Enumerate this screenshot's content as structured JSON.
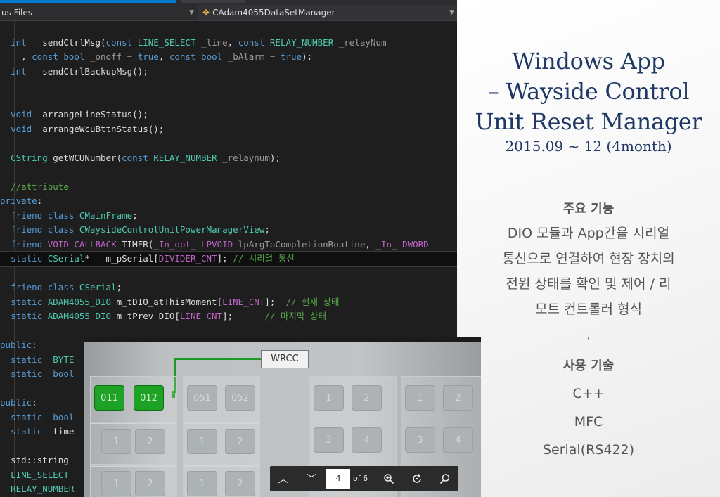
{
  "editor": {
    "solution_dropdown": "us Files",
    "class_dropdown": "CAdam4055DataSetManager",
    "lines": [
      [],
      [
        [
          "t",
          "  "
        ],
        [
          "kw",
          "int"
        ],
        [
          "t",
          "   sendCtrlMsg("
        ],
        [
          "kw",
          "const"
        ],
        [
          "t",
          " "
        ],
        [
          "ty",
          "LINE_SELECT"
        ],
        [
          "t",
          " "
        ],
        [
          "pm",
          "_line"
        ],
        [
          "t",
          ", "
        ],
        [
          "kw",
          "const"
        ],
        [
          "t",
          " "
        ],
        [
          "ty",
          "RELAY_NUMBER"
        ],
        [
          "t",
          " "
        ],
        [
          "pm",
          "_relayNum"
        ]
      ],
      [
        [
          "t",
          "    , "
        ],
        [
          "kw",
          "const"
        ],
        [
          "t",
          " "
        ],
        [
          "kw",
          "bool"
        ],
        [
          "t",
          " "
        ],
        [
          "pm",
          "_onoff"
        ],
        [
          "t",
          " = "
        ],
        [
          "kw",
          "true"
        ],
        [
          "t",
          ", "
        ],
        [
          "kw",
          "const"
        ],
        [
          "t",
          " "
        ],
        [
          "kw",
          "bool"
        ],
        [
          "t",
          " "
        ],
        [
          "pm",
          "_bAlarm"
        ],
        [
          "t",
          " = "
        ],
        [
          "kw",
          "true"
        ],
        [
          "t",
          ");"
        ]
      ],
      [
        [
          "t",
          "  "
        ],
        [
          "kw",
          "int"
        ],
        [
          "t",
          "   sendCtrlBackupMsg();"
        ]
      ],
      [],
      [],
      [
        [
          "t",
          "  "
        ],
        [
          "kw",
          "void"
        ],
        [
          "t",
          "  arrangeLineStatus();"
        ]
      ],
      [
        [
          "t",
          "  "
        ],
        [
          "kw",
          "void"
        ],
        [
          "t",
          "  arrangeWcuBttnStatus();"
        ]
      ],
      [],
      [
        [
          "t",
          "  "
        ],
        [
          "ty",
          "CString"
        ],
        [
          "t",
          " getWCUNumber("
        ],
        [
          "kw",
          "const"
        ],
        [
          "t",
          " "
        ],
        [
          "ty",
          "RELAY_NUMBER"
        ],
        [
          "t",
          " "
        ],
        [
          "pm",
          "_relaynum"
        ],
        [
          "t",
          ");"
        ]
      ],
      [],
      [
        [
          "t",
          "  "
        ],
        [
          "cm",
          "//attribute"
        ]
      ],
      [
        [
          "kw",
          "private"
        ],
        [
          "t",
          ":"
        ]
      ],
      [
        [
          "t",
          "  "
        ],
        [
          "kw",
          "friend"
        ],
        [
          "t",
          " "
        ],
        [
          "kw",
          "class"
        ],
        [
          "t",
          " "
        ],
        [
          "ty",
          "CMainFrame"
        ],
        [
          "t",
          ";"
        ]
      ],
      [
        [
          "t",
          "  "
        ],
        [
          "kw",
          "friend"
        ],
        [
          "t",
          " "
        ],
        [
          "kw",
          "class"
        ],
        [
          "t",
          " "
        ],
        [
          "ty",
          "CWaysideControlUnitPowerManagerView"
        ],
        [
          "t",
          ";"
        ]
      ],
      [
        [
          "t",
          "  "
        ],
        [
          "kw",
          "friend"
        ],
        [
          "t",
          " "
        ],
        [
          "mc",
          "VOID"
        ],
        [
          "t",
          " "
        ],
        [
          "mc",
          "CALLBACK"
        ],
        [
          "t",
          " TIMER("
        ],
        [
          "mc",
          "_In_opt_"
        ],
        [
          "t",
          " "
        ],
        [
          "mc",
          "LPVOID"
        ],
        [
          "t",
          " "
        ],
        [
          "pm",
          "lpArgToCompletionRoutine"
        ],
        [
          "t",
          ", "
        ],
        [
          "mc",
          "_In_"
        ],
        [
          "t",
          " "
        ],
        [
          "mc",
          "DWORD"
        ]
      ],
      [
        [
          "t",
          "  "
        ],
        [
          "kw",
          "static"
        ],
        [
          "t",
          " "
        ],
        [
          "ty",
          "CSerial"
        ],
        [
          "t",
          "*   m_pSerial["
        ],
        [
          "mc",
          "DIVIDER_CNT"
        ],
        [
          "t",
          "]; "
        ],
        [
          "cm",
          "// 시리얼 통신"
        ]
      ],
      [],
      [
        [
          "t",
          "  "
        ],
        [
          "kw",
          "friend"
        ],
        [
          "t",
          " "
        ],
        [
          "kw",
          "class"
        ],
        [
          "t",
          " "
        ],
        [
          "ty",
          "CSerial"
        ],
        [
          "t",
          ";"
        ]
      ],
      [
        [
          "t",
          "  "
        ],
        [
          "kw",
          "static"
        ],
        [
          "t",
          " "
        ],
        [
          "ty",
          "ADAM4055_DIO"
        ],
        [
          "t",
          " m_tDIO_atThisMoment["
        ],
        [
          "mc",
          "LINE_CNT"
        ],
        [
          "t",
          "];  "
        ],
        [
          "cm",
          "// 현재 상태"
        ]
      ],
      [
        [
          "t",
          "  "
        ],
        [
          "kw",
          "static"
        ],
        [
          "t",
          " "
        ],
        [
          "ty",
          "ADAM4055_DIO"
        ],
        [
          "t",
          " m_tPrev_DIO["
        ],
        [
          "mc",
          "LINE_CNT"
        ],
        [
          "t",
          "];      "
        ],
        [
          "cm",
          "// 마지막 상태"
        ]
      ],
      [],
      [
        [
          "kw",
          "public"
        ],
        [
          "t",
          ":"
        ]
      ],
      [
        [
          "t",
          "  "
        ],
        [
          "kw",
          "static"
        ],
        [
          "t",
          "  "
        ],
        [
          "ty",
          "BYTE"
        ]
      ],
      [
        [
          "t",
          "  "
        ],
        [
          "kw",
          "static"
        ],
        [
          "t",
          "  "
        ],
        [
          "kw",
          "bool"
        ]
      ],
      [],
      [
        [
          "kw",
          "public"
        ],
        [
          "t",
          ":"
        ]
      ],
      [
        [
          "t",
          "  "
        ],
        [
          "kw",
          "static"
        ],
        [
          "t",
          "  "
        ],
        [
          "kw",
          "bool"
        ]
      ],
      [
        [
          "t",
          "  "
        ],
        [
          "kw",
          "static"
        ],
        [
          "t",
          "  time"
        ]
      ],
      [],
      [
        [
          "t",
          "  std::string"
        ]
      ],
      [
        [
          "t",
          "  "
        ],
        [
          "ty",
          "LINE_SELECT"
        ]
      ],
      [
        [
          "t",
          "  "
        ],
        [
          "ty",
          "RELAY_NUMBER"
        ]
      ]
    ]
  },
  "slide": {
    "title_lines": [
      "Windows App",
      "– Wayside Control",
      "Unit Reset Manager"
    ],
    "date": "2015.09 ~ 12 (4month)",
    "features_heading": "주요 기능",
    "features_lines": [
      "DIO 모듈과 App간을 시리얼",
      "통신으로 연결하여 현장 장치의",
      "전원 상태를 확인 및 제어 / 리",
      "모트 컨트롤러 형식"
    ],
    "separator": ",",
    "tech_heading": "사용 기술",
    "tech_items": [
      "C++",
      "MFC",
      "Serial(RS422)"
    ]
  },
  "photo": {
    "wrcc_label": "WRCC",
    "tiles_on": [
      "011",
      "012"
    ],
    "tiles_row1": [
      "051",
      "052"
    ],
    "group_tiles": [
      "1",
      "2",
      "3",
      "4"
    ]
  },
  "pdf_toolbar": {
    "page_current": "4",
    "page_total_label": "of 6",
    "prev_icon": "chevron-up-icon",
    "next_icon": "chevron-down-icon"
  }
}
